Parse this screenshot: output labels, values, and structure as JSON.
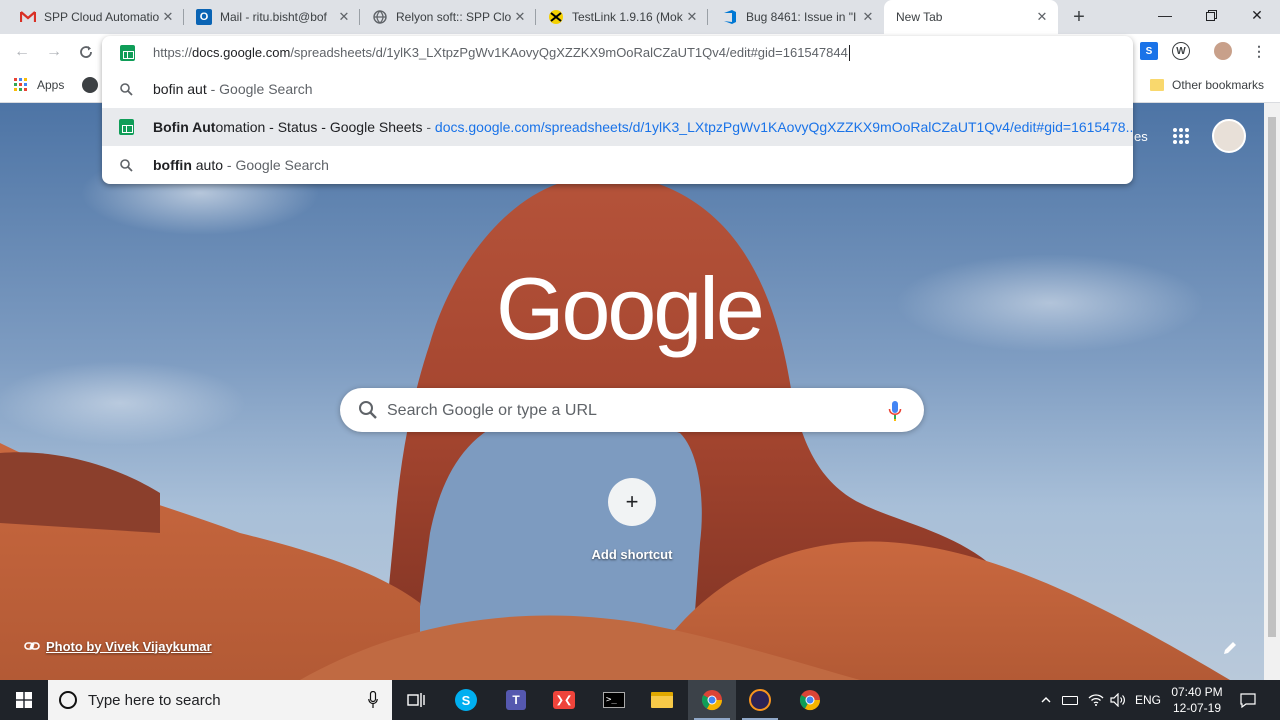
{
  "tabs": [
    {
      "title": "SPP Cloud Automatio",
      "icon": "gmail-icon"
    },
    {
      "title": "Mail - ritu.bisht@bof",
      "icon": "outlook-icon"
    },
    {
      "title": "Relyon soft:: SPP Clo",
      "icon": "globe-icon"
    },
    {
      "title": "TestLink 1.9.16 (Mok",
      "icon": "testlink-icon"
    },
    {
      "title": "Bug 8461: Issue in \"I",
      "icon": "azure-devops-icon"
    },
    {
      "title": "New Tab",
      "icon": "none"
    }
  ],
  "omnibox": {
    "url_text": "https://docs.google.com/spreadsheets/d/1ylK3_LXtpzPgWv1KAovyQgXZZKX9mOoRalCZaUT1Qv4/edit#gid=161547844",
    "url_prefix": "https://",
    "url_host": "docs.google.com",
    "url_path": "/spreadsheets/d/1ylK3_LXtpzPgWv1KAovyQgXZZKX9mOoRalCZaUT1Qv4/edit#gid=161547844",
    "suggestions": [
      {
        "type": "search",
        "match": "bofin aut",
        "rest": "",
        "suffix": " - Google Search"
      },
      {
        "type": "sheet",
        "match": "Bofin Aut",
        "rest": "omation - Status - Google Sheets",
        "sep": " - ",
        "url": "docs.google.com/spreadsheets/d/1ylK3_LXtpzPgWv1KAovyQgXZZKX9mOoRalCZaUT1Qv4/edit#gid=1615478..."
      },
      {
        "type": "search",
        "match": "boffin",
        "rest": " auto",
        "suffix": " - Google Search"
      }
    ]
  },
  "bookmarks": {
    "apps_label": "Apps",
    "other_label": "Other bookmarks"
  },
  "ntp": {
    "logo": "Google",
    "search_placeholder": "Search Google or type a URL",
    "add_shortcut_label": "Add shortcut",
    "add_shortcut_symbol": "+",
    "attribution": "Photo by Vivek Vijaykumar",
    "top_right_partial": "es"
  },
  "taskbar": {
    "search_placeholder": "Type here to search",
    "language": "ENG",
    "time": "07:40 PM",
    "date": "12-07-19"
  },
  "colors": {
    "accent": "#1a73e8",
    "sheets": "#0f9d58",
    "taskbar": "#1f2329",
    "tabstrip": "#dee1e6"
  }
}
